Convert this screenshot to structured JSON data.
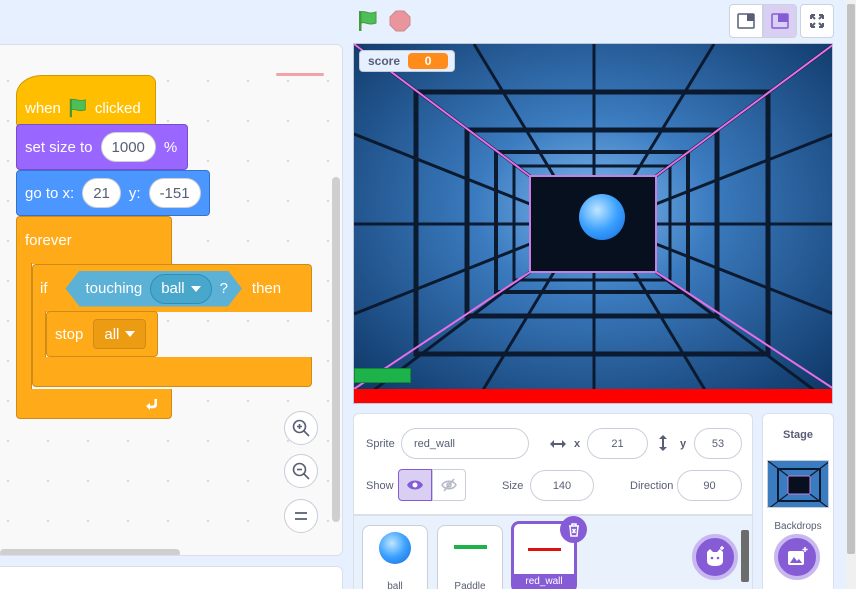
{
  "header": {
    "green_flag": "green-flag-icon",
    "stop": "stop-icon",
    "layout_buttons": [
      "small-stage-icon",
      "normal-stage-icon",
      "fullscreen-icon"
    ]
  },
  "code": {
    "when_label": "when",
    "clicked_label": "clicked",
    "set_size_label": "set size to",
    "size_value": "1000",
    "percent": "%",
    "go_to_label": "go to x:",
    "x_value": "21",
    "y_label": "y:",
    "y_value": "-151",
    "forever_label": "forever",
    "if_label": "if",
    "touching_label": "touching",
    "touching_target": "ball",
    "question": "?",
    "then_label": "then",
    "stop_label": "stop",
    "stop_option": "all"
  },
  "stage": {
    "monitor_label": "score",
    "monitor_value": "0"
  },
  "sprite_info": {
    "sprite_label": "Sprite",
    "sprite_name": "red_wall",
    "x_label": "x",
    "x_value": "21",
    "y_label": "y",
    "y_value": "53",
    "show_label": "Show",
    "size_label": "Size",
    "size_value": "140",
    "direction_label": "Direction",
    "direction_value": "90"
  },
  "sprites": [
    {
      "name": "ball"
    },
    {
      "name": "Paddle"
    },
    {
      "name": "red_wall"
    }
  ],
  "stage_panel": {
    "title": "Stage",
    "backdrops_label": "Backdrops"
  },
  "colors": {
    "accent": "#855cd6",
    "events": "#ffbf00",
    "looks": "#9966ff",
    "motion": "#4c97ff",
    "control": "#ffab19",
    "sensing": "#5cb1d6",
    "monitor": "#ff8c1a"
  }
}
